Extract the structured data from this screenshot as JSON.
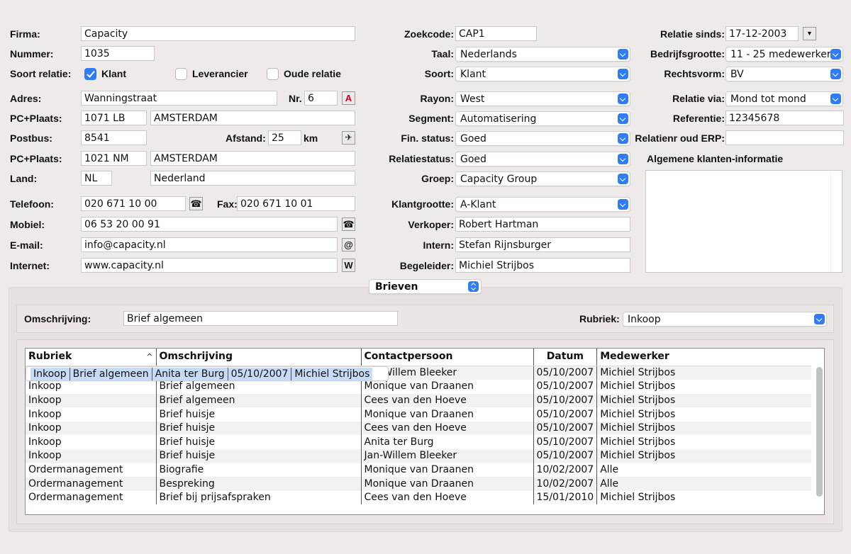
{
  "colors": {
    "accent": "#2f7cf6",
    "selected_row": "#c5dbf6",
    "background": "#efeaea"
  },
  "left": {
    "firma_label": "Firma:",
    "firma_value": "Capacity",
    "nummer_label": "Nummer:",
    "nummer_value": "1035",
    "soort_relatie_label": "Soort relatie:",
    "klant_label": "Klant",
    "leverancier_label": "Leverancier",
    "oude_relatie_label": "Oude relatie",
    "adres_label": "Adres:",
    "adres_value": "Wanningstraat",
    "nr_label": "Nr.",
    "nr_value": "6",
    "pc_plaats_label": "PC+Plaats:",
    "pc_value": "1071 LB",
    "plaats_value": "AMSTERDAM",
    "postbus_label": "Postbus:",
    "postbus_value": "8541",
    "afstand_label": "Afstand:",
    "afstand_value": "25",
    "km_label": "km",
    "pc_plaats2_label": "PC+Plaats:",
    "pc2_value": "1021 NM",
    "plaats2_value": "AMSTERDAM",
    "land_label": "Land:",
    "land_code": "NL",
    "land_value": "Nederland",
    "telefoon_label": "Telefoon:",
    "telefoon_value": "020 671 10 00",
    "fax_label": "Fax:",
    "fax_value": "020 671 10 01",
    "mobiel_label": "Mobiel:",
    "mobiel_value": "06 53 20 00 91",
    "email_label": "E-mail:",
    "email_value": "info@capacity.nl",
    "internet_label": "Internet:",
    "internet_value": "www.capacity.nl"
  },
  "middle": {
    "zoekcode_label": "Zoekcode:",
    "zoekcode_value": "CAP1",
    "taal_label": "Taal:",
    "taal_value": "Nederlands",
    "soort_label": "Soort:",
    "soort_value": "Klant",
    "rayon_label": "Rayon:",
    "rayon_value": "West",
    "segment_label": "Segment:",
    "segment_value": "Automatisering",
    "fin_status_label": "Fin. status:",
    "fin_status_value": "Goed",
    "relatiestatus_label": "Relatiestatus:",
    "relatiestatus_value": "Goed",
    "groep_label": "Groep:",
    "groep_value": "Capacity Group",
    "klantgrootte_label": "Klantgrootte:",
    "klantgrootte_value": "A-Klant",
    "verkoper_label": "Verkoper:",
    "verkoper_value": "Robert Hartman",
    "intern_label": "Intern:",
    "intern_value": "Stefan Rijnsburger",
    "begeleider_label": "Begeleider:",
    "begeleider_value": "Michiel Strijbos"
  },
  "right": {
    "relatie_sinds_label": "Relatie sinds:",
    "relatie_sinds_value": "17-12-2003",
    "bedrijfsgrootte_label": "Bedrijfsgrootte:",
    "bedrijfsgrootte_value": "11 - 25 medewerkers",
    "rechtsvorm_label": "Rechtsvorm:",
    "rechtsvorm_value": "BV",
    "relatie_via_label": "Relatie via:",
    "relatie_via_value": "Mond tot mond",
    "referentie_label": "Referentie:",
    "referentie_value": "12345678",
    "relatienr_label": "Relatienr oud ERP:",
    "relatienr_value": "",
    "algemene_label": "Algemene klanten-informatie"
  },
  "bottom": {
    "popup_value": "Brieven",
    "omschrijving_label": "Omschrijving:",
    "omschrijving_value": "Brief algemeen",
    "rubriek_label": "Rubriek:",
    "rubriek_value": "Inkoop",
    "table": {
      "columns": [
        "Rubriek",
        "Omschrijving",
        "Contactpersoon",
        "Datum",
        "Medewerker"
      ],
      "rows": [
        [
          "Inkoop",
          "Brief algemeen",
          "Anita ter Burg",
          "05/10/2007",
          "Michiel Strijbos"
        ],
        [
          "Inkoop",
          "Brief algemeen",
          "Jan-Willem Bleeker",
          "05/10/2007",
          "Michiel Strijbos"
        ],
        [
          "Inkoop",
          "Brief algemeen",
          "Monique van Draanen",
          "05/10/2007",
          "Michiel Strijbos"
        ],
        [
          "Inkoop",
          "Brief algemeen",
          "Cees van den Hoeve",
          "05/10/2007",
          "Michiel Strijbos"
        ],
        [
          "Inkoop",
          "Brief huisje",
          "Monique van Draanen",
          "05/10/2007",
          "Michiel Strijbos"
        ],
        [
          "Inkoop",
          "Brief huisje",
          "Cees van den Hoeve",
          "05/10/2007",
          "Michiel Strijbos"
        ],
        [
          "Inkoop",
          "Brief huisje",
          "Anita ter Burg",
          "05/10/2007",
          "Michiel Strijbos"
        ],
        [
          "Inkoop",
          "Brief huisje",
          "Jan-Willem Bleeker",
          "05/10/2007",
          "Michiel Strijbos"
        ],
        [
          "Ordermanagement",
          "Biografie",
          "Monique van Draanen",
          "10/02/2007",
          "Alle"
        ],
        [
          "Ordermanagement",
          "Bespreking",
          "Monique van Draanen",
          "10/02/2007",
          "Alle"
        ],
        [
          "Ordermanagement",
          "Brief bij prijsafspraken",
          "Cees van den Hoeve",
          "15/01/2010",
          "Michiel Strijbos"
        ]
      ]
    }
  }
}
